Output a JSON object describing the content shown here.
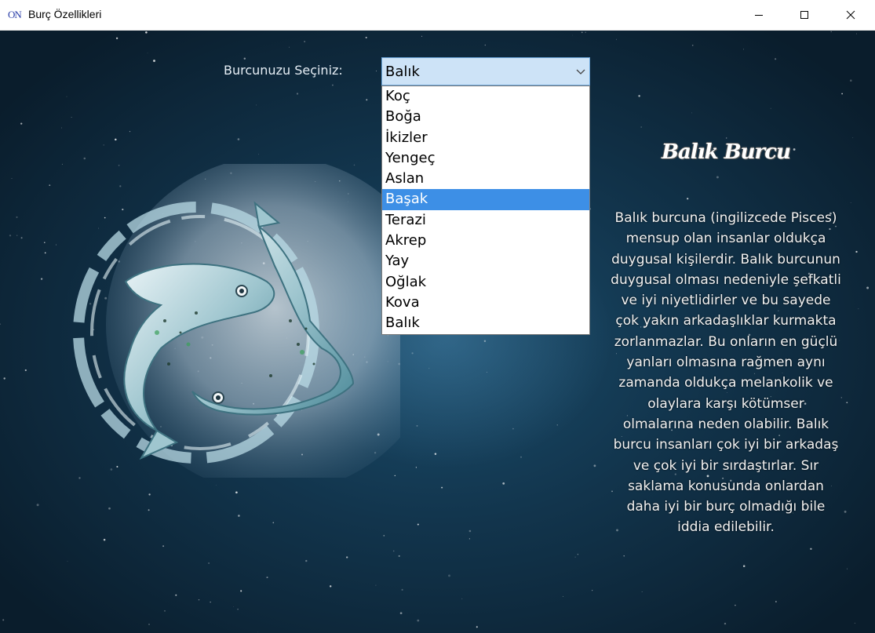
{
  "window": {
    "title": "Burç Özellikleri",
    "icon_text": "ON"
  },
  "form": {
    "label": "Burcunuzu Seçiniz:",
    "selected_value": "Balık",
    "options": [
      "Koç",
      "Boğa",
      "İkizler",
      "Yengeç",
      "Aslan",
      "Başak",
      "Terazi",
      "Akrep",
      "Yay",
      "Oğlak",
      "Kova",
      "Balık"
    ],
    "highlighted_option": "Başak"
  },
  "sign": {
    "title": "Balık Burcu",
    "description": "Balık burcuna (ingilizcede Pisces) mensup olan insanlar oldukça duygusal kişilerdir. Balık burcunun duygusal olması nedeniyle şefkatli ve iyi niyetlidirler ve bu sayede çok yakın arkadaşlıklar kurmakta zorlanmazlar. Bu onların en güçlü yanları olmasına rağmen aynı zamanda oldukça melankolik ve olaylara karşı kötümser olmalarına neden olabilir. Balık burcu insanları çok iyi bir arkadaş ve çok iyi bir sırdaştırlar. Sır saklama konusunda onlardan daha iyi bir burç olmadığı bile iddia edilebilir."
  },
  "colors": {
    "background": "#12354d",
    "combo_background": "#cde3f7",
    "selection": "#3d8fe6"
  }
}
